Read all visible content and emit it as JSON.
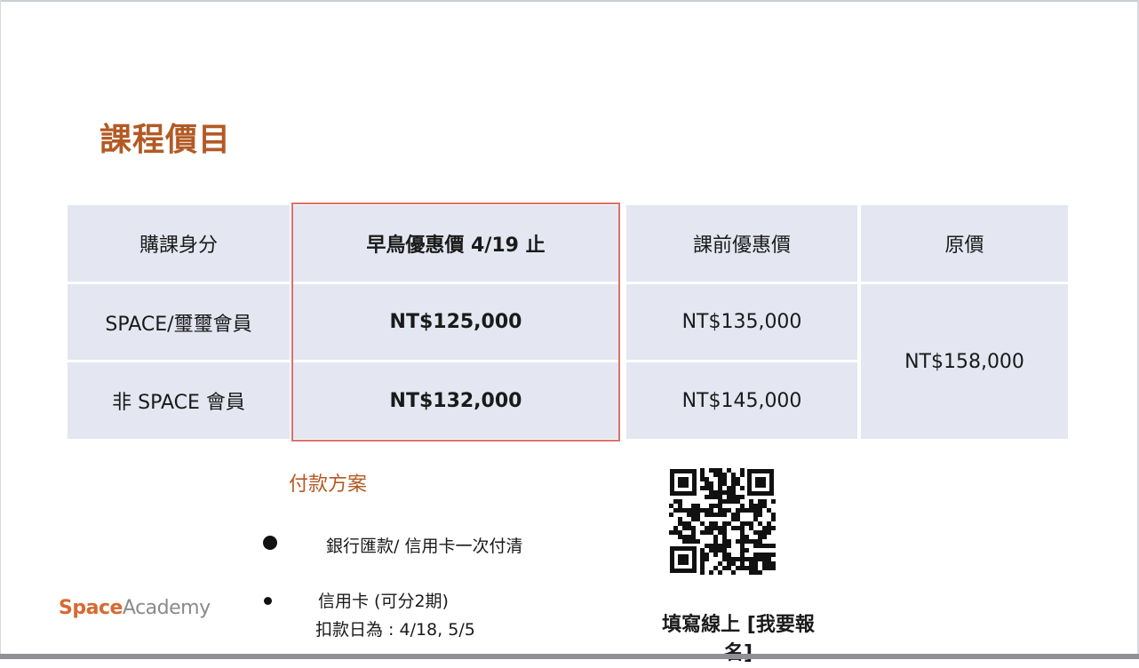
{
  "page": {
    "title": "課程價目"
  },
  "pricing_table": {
    "headers": [
      "購課身分",
      "早鳥優惠價 4/19 止",
      "課前優惠價",
      "原價"
    ],
    "rows": [
      {
        "identity": "SPACE/璽璽會員",
        "early_bird": "NT$125,000",
        "pre_course": "NT$135,000"
      },
      {
        "identity": "非 SPACE 會員",
        "early_bird": "NT$132,000",
        "pre_course": "NT$145,000"
      }
    ],
    "original_price": "NT$158,000",
    "highlight_color": "#d9736a",
    "cell_color": "#e4e6f1"
  },
  "payment": {
    "heading": "付款方案",
    "items": [
      {
        "label": "銀行匯款/ 信用卡一次付清"
      },
      {
        "label": "信用卡 (可分2期)",
        "sub": "扣款日為 : 4/18, 5/5"
      }
    ]
  },
  "brand": {
    "part1": "Space",
    "part2": "Academy",
    "accent": "#d66a33"
  },
  "signup": {
    "line1": "填寫線上 [我要報",
    "line2": "名]"
  },
  "qr": {
    "icon": "qr-code-icon"
  },
  "colors": {
    "title": "#b35a24",
    "heading": "#b35a24"
  }
}
